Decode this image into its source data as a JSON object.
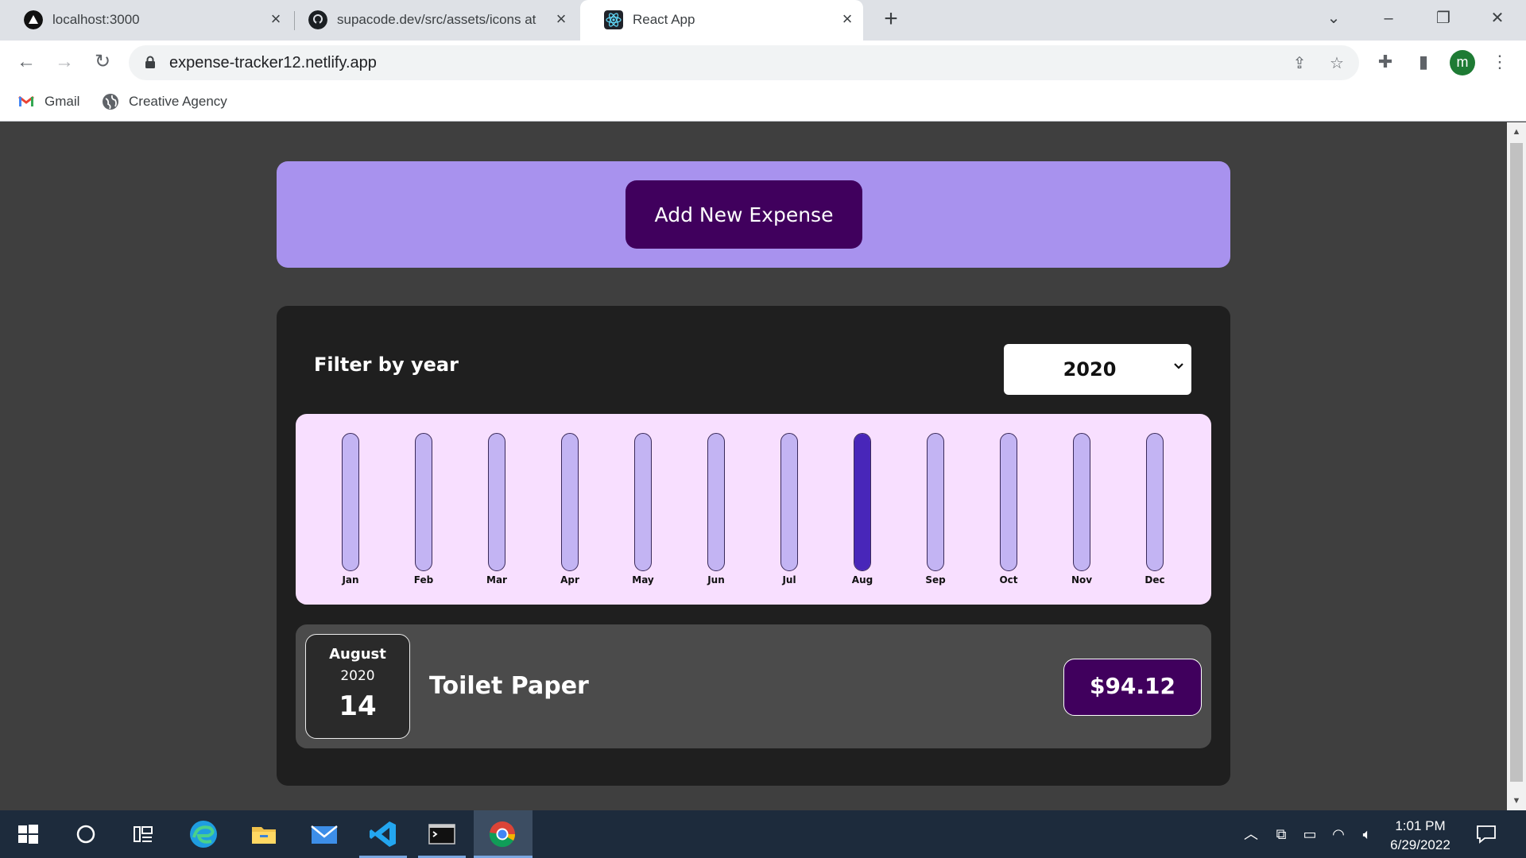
{
  "browser": {
    "tabs": [
      {
        "title": "localhost:3000",
        "icon": "vercel-triangle-icon"
      },
      {
        "title": "supacode.dev/src/assets/icons at",
        "icon": "github-icon"
      },
      {
        "title": "React App",
        "icon": "react-icon",
        "active": true
      }
    ],
    "url": "expense-tracker12.netlify.app",
    "bookmarks": [
      {
        "label": "Gmail",
        "icon": "gmail-icon"
      },
      {
        "label": "Creative Agency",
        "icon": "globe-icon"
      }
    ],
    "profile_initial": "m"
  },
  "app": {
    "add_button_label": "Add New Expense",
    "filter_label": "Filter by year",
    "selected_year": "2020",
    "colors": {
      "background": "#3f3f3f",
      "new_expense_panel": "#a892ee",
      "button": "#40005d",
      "chart_background": "#f8dfff",
      "bar_empty": "#c3b4f3",
      "bar_fill": "#4826b9"
    }
  },
  "chart_data": {
    "type": "bar",
    "categories": [
      "Jan",
      "Feb",
      "Mar",
      "Apr",
      "May",
      "Jun",
      "Jul",
      "Aug",
      "Sep",
      "Oct",
      "Nov",
      "Dec"
    ],
    "values": [
      0,
      0,
      0,
      0,
      0,
      0,
      0,
      94.12,
      0,
      0,
      0,
      0
    ],
    "ylim": [
      0,
      94.12
    ]
  },
  "expenses": [
    {
      "month": "August",
      "year": "2020",
      "day": "14",
      "title": "Toilet Paper",
      "amount": "$94.12"
    }
  ],
  "taskbar": {
    "time": "1:01 PM",
    "date": "6/29/2022"
  }
}
